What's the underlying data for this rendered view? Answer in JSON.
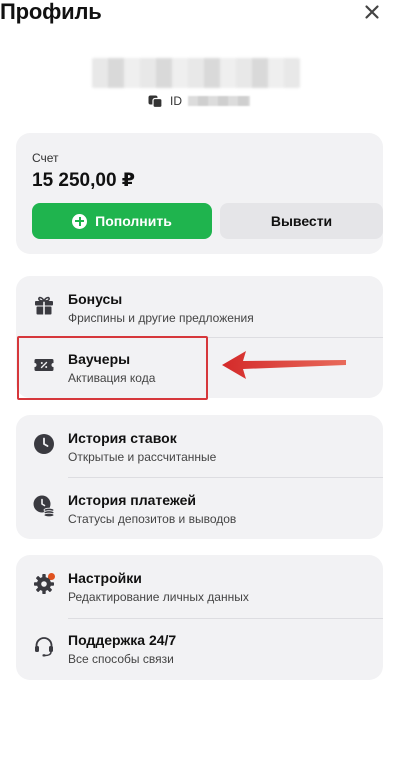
{
  "header": {
    "title": "Профиль"
  },
  "user": {
    "id_label": "ID"
  },
  "balance": {
    "label": "Счет",
    "value": "15 250,00 ₽",
    "deposit_label": "Пополнить",
    "withdraw_label": "Вывести"
  },
  "menu": {
    "bonuses": {
      "title": "Бонусы",
      "subtitle": "Фриспины и другие предложения"
    },
    "vouchers": {
      "title": "Ваучеры",
      "subtitle": "Активация кода"
    },
    "bet_history": {
      "title": "История ставок",
      "subtitle": "Открытые и рассчитанные"
    },
    "payment_history": {
      "title": "История платежей",
      "subtitle": "Статусы депозитов и выводов"
    },
    "settings": {
      "title": "Настройки",
      "subtitle": "Редактирование личных данных"
    },
    "support": {
      "title": "Поддержка 24/7",
      "subtitle": "Все способы связи"
    }
  },
  "colors": {
    "accent_green": "#1fb44e",
    "card_bg": "#f2f2f4",
    "annotation_red": "#d6373b",
    "notification_dot": "#e0521f"
  },
  "icons": [
    "close-icon",
    "copy-icon",
    "plus-circle-icon",
    "gift-icon",
    "voucher-icon",
    "clock-icon",
    "payment-clock-icon",
    "gear-icon",
    "headset-icon",
    "arrow-annotation"
  ]
}
